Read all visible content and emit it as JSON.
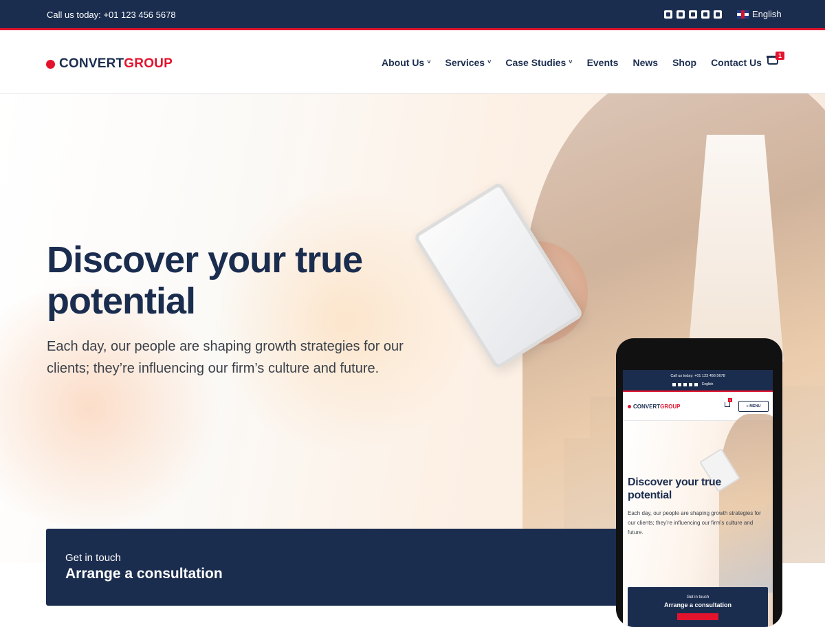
{
  "topbar": {
    "call_text": "Call us today: +01 123 456 5678",
    "social_icons": [
      "facebook-icon",
      "twitter-icon",
      "instagram-icon",
      "youtube-icon",
      "linkedin-icon"
    ],
    "language": "English"
  },
  "header": {
    "logo_part1": "CONVERT",
    "logo_part2": "GROUP",
    "nav": [
      {
        "label": "About Us",
        "dropdown": true
      },
      {
        "label": "Services",
        "dropdown": true
      },
      {
        "label": "Case Studies",
        "dropdown": true
      },
      {
        "label": "Events",
        "dropdown": false
      },
      {
        "label": "News",
        "dropdown": false
      },
      {
        "label": "Shop",
        "dropdown": false
      },
      {
        "label": "Contact Us",
        "dropdown": false
      }
    ],
    "cart_count": "1"
  },
  "hero": {
    "title": "Discover your true potential",
    "text": "Each day, our people are shaping growth strategies for our clients; they’re influencing our firm’s culture and future."
  },
  "cta": {
    "small": "Get in touch",
    "big": "Arrange a consultation"
  },
  "mobile": {
    "call_text": "Call us today: +01 123 456 5678",
    "language": "English",
    "logo_part1": "CONVERT",
    "logo_part2": "GROUP",
    "cart_count": "1",
    "menu_label": "≡ MENU",
    "title": "Discover your true potential",
    "text": "Each day, our people are shaping growth strategies for our clients; they’re influencing our firm’s culture and future.",
    "cta_small": "Get in touch",
    "cta_big": "Arrange a consultation"
  },
  "colors": {
    "navy": "#1b2d4f",
    "accent_red": "#e3132d"
  }
}
